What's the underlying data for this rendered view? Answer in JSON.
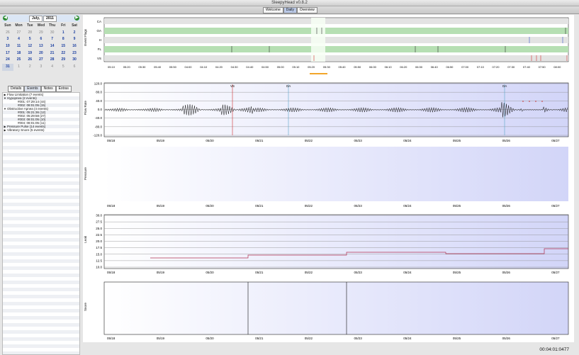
{
  "window": {
    "title": "SleepyHead v0.8.2"
  },
  "toolbar": {
    "tabs": [
      "Welcome",
      "Daily",
      "Overview"
    ],
    "active": "Daily"
  },
  "calendar": {
    "month": "July,",
    "year": "2011",
    "prev_icon": "◀",
    "next_icon": "▶",
    "weekdays": [
      "Sun",
      "Mon",
      "Tue",
      "Wed",
      "Thu",
      "Fri",
      "Sat"
    ],
    "weeks": [
      [
        "26",
        "27",
        "28",
        "29",
        "30",
        "1",
        "2"
      ],
      [
        "3",
        "4",
        "5",
        "6",
        "7",
        "8",
        "9"
      ],
      [
        "10",
        "11",
        "12",
        "13",
        "14",
        "15",
        "16"
      ],
      [
        "17",
        "18",
        "19",
        "20",
        "21",
        "22",
        "23"
      ],
      [
        "24",
        "25",
        "26",
        "27",
        "28",
        "29",
        "30"
      ],
      [
        "31",
        "1",
        "2",
        "3",
        "4",
        "5",
        "6"
      ]
    ]
  },
  "left_tabs": [
    "Details",
    "Events",
    "Notes",
    "Extras"
  ],
  "events": [
    {
      "tri": "▶",
      "label": "Flow Limitation (7 events)",
      "level": 0
    },
    {
      "tri": "▼",
      "label": "Hypopnea (2 events)",
      "level": 0
    },
    {
      "tri": "",
      "label": "#001: 07:29:14 (44)",
      "level": 1
    },
    {
      "tri": "",
      "label": "#002: 08:01:05 (15)",
      "level": 1
    },
    {
      "tri": "▼",
      "label": "Obstructive Apnea (4 events)",
      "level": 0
    },
    {
      "tri": "",
      "label": "#001: 05:21:36 (12)",
      "level": 1
    },
    {
      "tri": "",
      "label": "#002: 05:29:58 (27)",
      "level": 1
    },
    {
      "tri": "",
      "label": "#003: 08:01:05 (10)",
      "level": 1
    },
    {
      "tri": "",
      "label": "#004: 08:01:05 (11)",
      "level": 1
    },
    {
      "tri": "▶",
      "label": "Pressure Pulse (14 events)",
      "level": 0
    },
    {
      "tri": "▶",
      "label": "Vibratory Snore (5 events)",
      "level": 0
    }
  ],
  "flags": {
    "ylabel": "Event Flags",
    "rows": [
      "CA",
      "OA",
      "H",
      "FL",
      "VS"
    ],
    "ticks": [
      "05:10",
      "05:20",
      "05:30",
      "05:40",
      "05:50",
      "04:00",
      "04:10",
      "04:20",
      "04:30",
      "04:40",
      "04:50",
      "05:00",
      "05:10",
      "05:20",
      "05:30",
      "05:40",
      "05:50",
      "06:00",
      "06:10",
      "06:20",
      "06:30",
      "06:40",
      "06:50",
      "07:00",
      "07:10",
      "07:20",
      "07:30",
      "07:40",
      "07:50",
      "08:00"
    ]
  },
  "flow": {
    "ylabel": "Flow Rate",
    "yticks": [
      "120.0",
      "80.0",
      "40.0",
      "0.0",
      "-40.0",
      "-80.0",
      "-120.0"
    ],
    "markers": [
      "VS",
      "OA",
      "OA"
    ]
  },
  "pressure": {
    "ylabel": "Pressure"
  },
  "leak": {
    "ylabel": "Leak",
    "yticks": [
      "30.0",
      "27.5",
      "25.0",
      "22.5",
      "20.0",
      "17.5",
      "15.0",
      "12.5",
      "10.0"
    ]
  },
  "snore": {
    "ylabel": "Snore"
  },
  "xticks": [
    "05/18",
    "05/19",
    "05/20",
    "05/21",
    "05/22",
    "05/23",
    "05/24",
    "05/25",
    "05/26",
    "05/27"
  ],
  "status": {
    "clock": "00:04:01:0477"
  },
  "colors": {
    "flag_band": "#b6dfb3",
    "accent": "#f2a62a",
    "graph_bg_end": "#d2d5f8"
  }
}
